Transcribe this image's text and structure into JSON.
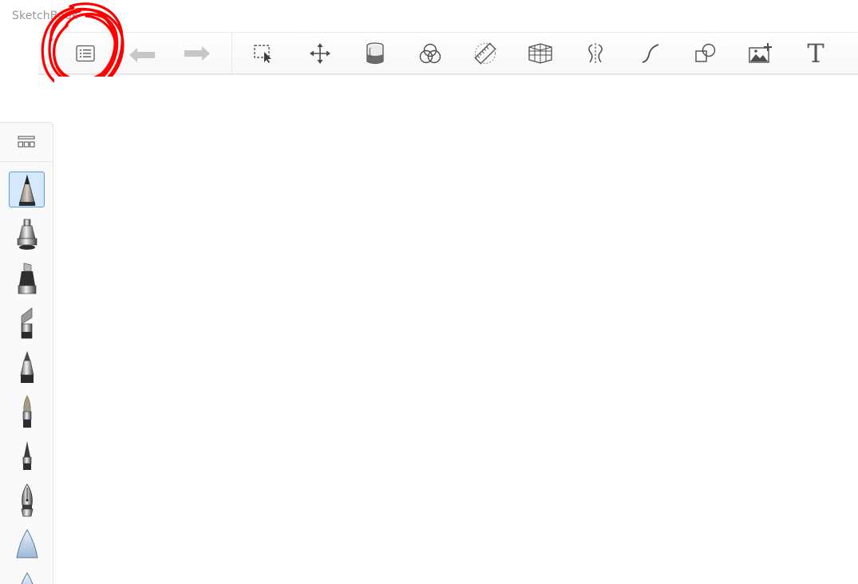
{
  "app": {
    "title": "SketchBook"
  },
  "toolbar": {
    "buttons": [
      {
        "id": "lagoon-menu",
        "icon": "list-icon"
      },
      {
        "id": "undo",
        "icon": "undo-arrow-icon"
      },
      {
        "id": "redo",
        "icon": "redo-arrow-icon"
      },
      {
        "id": "selection",
        "icon": "marquee-select-icon"
      },
      {
        "id": "transform",
        "icon": "move-arrows-icon"
      },
      {
        "id": "fill",
        "icon": "paint-bucket-icon"
      },
      {
        "id": "color-editor",
        "icon": "color-circles-icon"
      },
      {
        "id": "ruler",
        "icon": "ruler-icon"
      },
      {
        "id": "perspective",
        "icon": "perspective-grid-icon"
      },
      {
        "id": "symmetry",
        "icon": "symmetry-icon"
      },
      {
        "id": "steady-stroke",
        "icon": "curve-stroke-icon"
      },
      {
        "id": "shapes",
        "icon": "shapes-icon"
      },
      {
        "id": "add-image",
        "icon": "add-image-icon"
      },
      {
        "id": "text",
        "icon": "text-icon",
        "glyph": "T"
      }
    ]
  },
  "annotation": {
    "target": "lagoon-menu",
    "color": "#ff0000"
  },
  "brush_palette": {
    "header_icon": "brush-library-icon",
    "selected_index": 0,
    "brushes": [
      "pencil-brush-icon",
      "airbrush-icon",
      "marker-icon",
      "chisel-marker-icon",
      "ballpoint-pen-icon",
      "paintbrush-icon",
      "fine-pen-icon",
      "fountain-pen-icon",
      "hard-eraser-icon",
      "soft-eraser-icon"
    ]
  },
  "colors": {
    "toolbar_bg": "#f7f7f7",
    "icon": "#5a5a5a",
    "icon_disabled": "#c4c4c4",
    "selection_bg": "#d6e9fb",
    "selection_border": "#4e9ee8"
  }
}
